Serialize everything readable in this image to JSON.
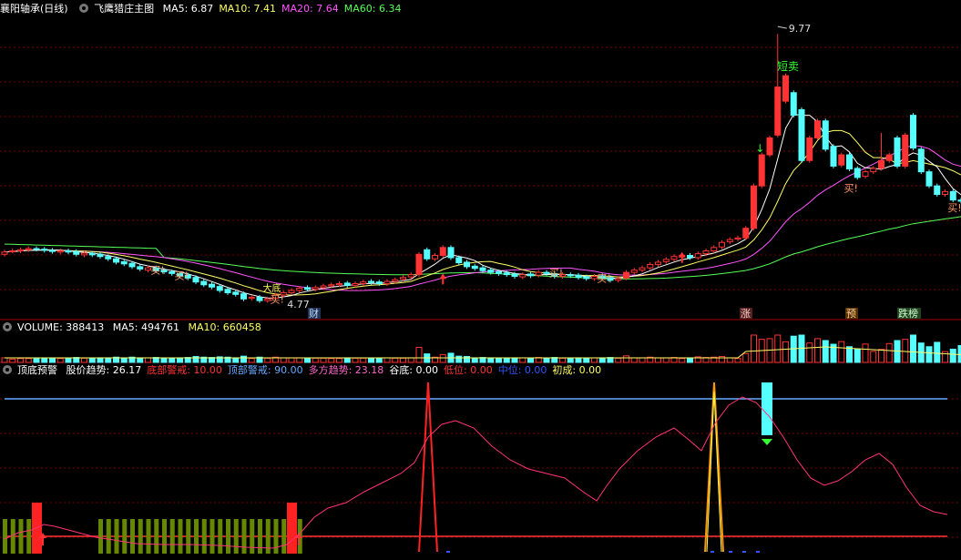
{
  "main": {
    "title": "襄阳轴承(日线)",
    "indicator_name": "飞鹰猎庄主图",
    "ma": [
      {
        "label": "MA5: 6.87",
        "color": "#ffffff"
      },
      {
        "label": "MA10: 7.41",
        "color": "#ffff66"
      },
      {
        "label": "MA20: 7.64",
        "color": "#ff55ff"
      },
      {
        "label": "MA60: 6.34",
        "color": "#55ff55"
      }
    ],
    "high_label": "9.77",
    "low_label": "4.77",
    "short_sell_label": "短卖",
    "buy_label": "买!",
    "low_marker_text": "大底",
    "event_badges": [
      "财",
      "涨",
      "预",
      "跌榜"
    ]
  },
  "volume": {
    "label": "VOLUME: 388413",
    "ma5": "MA5: 494761",
    "ma10": "MA10: 660458"
  },
  "warn": {
    "name": "顶底预警",
    "items": [
      {
        "label": "股价趋势: 26.17",
        "color": "#ffffff"
      },
      {
        "label": "底部警戒: 10.00",
        "color": "#ff3333"
      },
      {
        "label": "顶部警戒: 90.00",
        "color": "#66aaff"
      },
      {
        "label": "多方趋势: 23.18",
        "color": "#ff66cc"
      },
      {
        "label": "谷底: 0.00",
        "color": "#ffffff"
      },
      {
        "label": "低位: 0.00",
        "color": "#ff3333"
      },
      {
        "label": "中位: 0.00",
        "color": "#3355ff"
      },
      {
        "label": "初成: 0.00",
        "color": "#ffff66"
      }
    ]
  },
  "colors": {
    "up": "#ff3333",
    "down": "#55ffff",
    "ma5": "#ffffff",
    "ma10": "#ffff66",
    "ma20": "#ff55ff",
    "ma60": "#55ff55",
    "grid": "#7a0000",
    "divider": "#a00000",
    "buy": "#ff9966",
    "sell": "#33ff33",
    "trend": "#ff3377"
  },
  "chart_data": {
    "type": "candlestick",
    "y_range": [
      4.6,
      9.95
    ],
    "closes": [
      5.78,
      5.8,
      5.82,
      5.84,
      5.83,
      5.81,
      5.79,
      5.8,
      5.78,
      5.74,
      5.76,
      5.73,
      5.7,
      5.66,
      5.6,
      5.57,
      5.52,
      5.48,
      5.5,
      5.45,
      5.43,
      5.4,
      5.36,
      5.32,
      5.25,
      5.2,
      5.16,
      5.1,
      5.06,
      5.03,
      4.95,
      4.98,
      4.92,
      4.95,
      5.02,
      5.06,
      5.1,
      5.14,
      5.12,
      5.15,
      5.18,
      5.2,
      5.22,
      5.19,
      5.22,
      5.25,
      5.24,
      5.22,
      5.26,
      5.29,
      5.33,
      5.38,
      5.74,
      5.66,
      5.72,
      5.86,
      5.68,
      5.59,
      5.52,
      5.49,
      5.45,
      5.42,
      5.4,
      5.38,
      5.35,
      5.38,
      5.36,
      5.42,
      5.4,
      5.35,
      5.38,
      5.36,
      5.33,
      5.31,
      5.35,
      5.32,
      5.28,
      5.31,
      5.42,
      5.46,
      5.5,
      5.56,
      5.6,
      5.65,
      5.7,
      5.72,
      5.68,
      5.75,
      5.8,
      5.86,
      5.95,
      6.0,
      6.03,
      6.2,
      6.95,
      7.5,
      7.8,
      8.7,
      8.9,
      8.2,
      7.4,
      7.8,
      8.1,
      7.6,
      7.3,
      7.5,
      7.25,
      7.1,
      7.2,
      7.26,
      7.4,
      7.5,
      7.3,
      7.85,
      7.62,
      7.2,
      6.95,
      6.8,
      6.85,
      6.7,
      6.68
    ],
    "opens": [
      5.74,
      5.8,
      5.8,
      5.82,
      5.84,
      5.83,
      5.81,
      5.78,
      5.8,
      5.79,
      5.73,
      5.76,
      5.74,
      5.7,
      5.66,
      5.61,
      5.58,
      5.52,
      5.46,
      5.5,
      5.46,
      5.43,
      5.4,
      5.37,
      5.33,
      5.26,
      5.21,
      5.17,
      5.12,
      5.07,
      5.04,
      4.96,
      4.98,
      4.92,
      4.96,
      5.02,
      5.06,
      5.1,
      5.15,
      5.12,
      5.15,
      5.18,
      5.2,
      5.23,
      5.19,
      5.22,
      5.26,
      5.25,
      5.22,
      5.26,
      5.3,
      5.34,
      5.38,
      5.82,
      5.66,
      5.72,
      5.86,
      5.68,
      5.6,
      5.53,
      5.5,
      5.46,
      5.43,
      5.41,
      5.39,
      5.34,
      5.39,
      5.37,
      5.42,
      5.4,
      5.35,
      5.38,
      5.37,
      5.34,
      5.31,
      5.36,
      5.33,
      5.28,
      5.32,
      5.42,
      5.46,
      5.5,
      5.56,
      5.61,
      5.65,
      5.7,
      5.72,
      5.68,
      5.75,
      5.8,
      5.87,
      5.96,
      6.01,
      6.03,
      6.2,
      6.95,
      7.5,
      7.85,
      8.45,
      8.6,
      8.3,
      7.4,
      7.8,
      8.1,
      7.65,
      7.32,
      7.5,
      7.26,
      7.12,
      7.2,
      7.26,
      7.4,
      7.8,
      7.3,
      8.2,
      7.6,
      7.2,
      6.95,
      6.8,
      6.85,
      6.7
    ]
  }
}
